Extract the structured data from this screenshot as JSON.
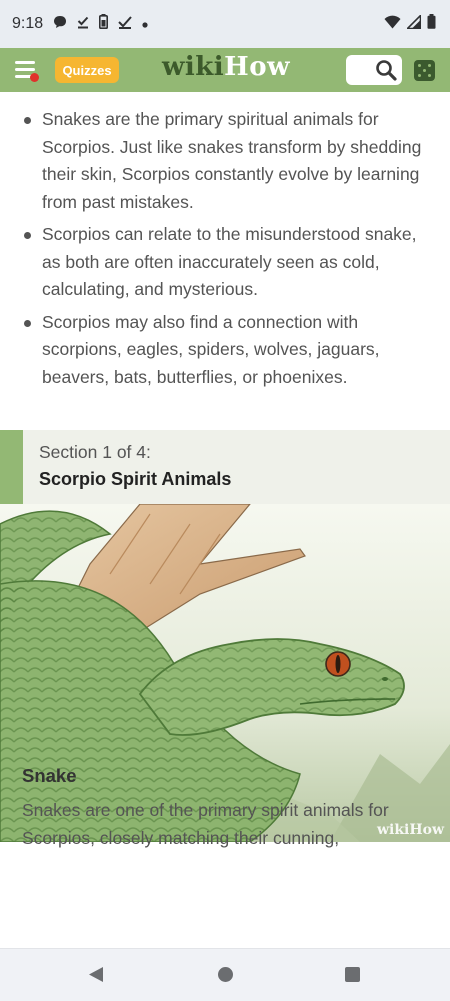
{
  "status_bar": {
    "time": "9:18"
  },
  "app_bar": {
    "quizzes_label": "Quizzes",
    "logo_wiki": "wiki",
    "logo_how": "How",
    "accent_color": "#93b874",
    "quizzes_color": "#f6b631"
  },
  "bullets": [
    "Snakes are the primary spiritual animals for Scorpios. Just like snakes transform by shedding their skin, Scorpios constantly evolve by learning from past mistakes.",
    "Scorpios can relate to the misunderstood snake, as both are often inaccurately seen as cold, calculating, and mysterious.",
    "Scorpios may also find a connection with scorpions, eagles, spiders, wolves, jaguars, beavers, bats, butterflies, or phoenixes."
  ],
  "section": {
    "number_text": "Section 1 of 4:",
    "title": "Scorpio Spirit Animals"
  },
  "image": {
    "watermark_wiki": "wiki",
    "watermark_how": "How"
  },
  "step": {
    "title": "Snake",
    "text": "Snakes are one of the primary spirit animals for Scorpios, closely matching their cunning,"
  },
  "icons": {
    "status_left": [
      "message-icon",
      "download-done-icon",
      "battery-saver-icon",
      "check-icon",
      "dot-icon"
    ],
    "status_right": [
      "wifi-icon",
      "signal-icon",
      "battery-icon"
    ],
    "app_bar": [
      "hamburger-icon",
      "search-icon",
      "dice-icon"
    ],
    "nav": [
      "back-icon",
      "home-icon",
      "recents-icon"
    ]
  }
}
